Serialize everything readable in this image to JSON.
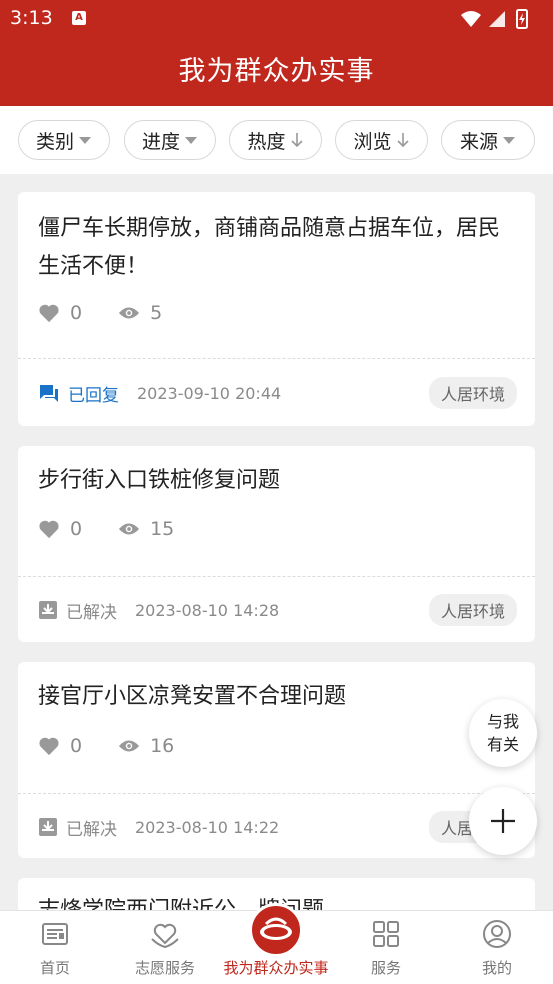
{
  "status_bar": {
    "time": "3:13",
    "notification_icon": "app-notification-icon",
    "icons": [
      "wifi-icon",
      "signal-icon",
      "battery-charging-icon"
    ]
  },
  "header": {
    "title": "我为群众办实事"
  },
  "filters": [
    {
      "label": "类别",
      "icon": "caret-down-icon"
    },
    {
      "label": "进度",
      "icon": "caret-down-icon"
    },
    {
      "label": "热度",
      "icon": "arrow-down-icon"
    },
    {
      "label": "浏览",
      "icon": "arrow-down-icon"
    },
    {
      "label": "来源",
      "icon": "caret-down-icon"
    }
  ],
  "cards": [
    {
      "title": "僵尸车长期停放，商铺商品随意占据车位，居民生活不便！",
      "likes": "0",
      "views": "5",
      "status": "已回复",
      "datetime": "2023-09-10 20:44",
      "tag": "人居环境"
    },
    {
      "title": "步行街入口铁桩修复问题",
      "likes": "0",
      "views": "15",
      "status": "已解决",
      "datetime": "2023-08-10 14:28",
      "tag": "人居环境"
    },
    {
      "title": "接官厅小区凉凳安置不合理问题",
      "likes": "0",
      "views": "16",
      "status": "已解决",
      "datetime": "2023-08-10 14:22",
      "tag": "人居环境"
    },
    {
      "title": "志烽学院西门附近公…牌问题"
    }
  ],
  "floating": {
    "related_line1": "与我",
    "related_line2": "有关",
    "add_icon": "plus-icon"
  },
  "tabbar": [
    {
      "label": "首页",
      "icon": "newspaper-icon"
    },
    {
      "label": "志愿服务",
      "icon": "heart-hands-icon"
    },
    {
      "label": "我为群众办实事",
      "icon": "center-logo-icon",
      "active": true
    },
    {
      "label": "服务",
      "icon": "grid-icon"
    },
    {
      "label": "我的",
      "icon": "user-icon"
    }
  ],
  "colors": {
    "brand_red": "#c0281e",
    "replied_blue": "#1a73c8",
    "muted_gray": "#8a8a8a",
    "background": "#efefef"
  }
}
